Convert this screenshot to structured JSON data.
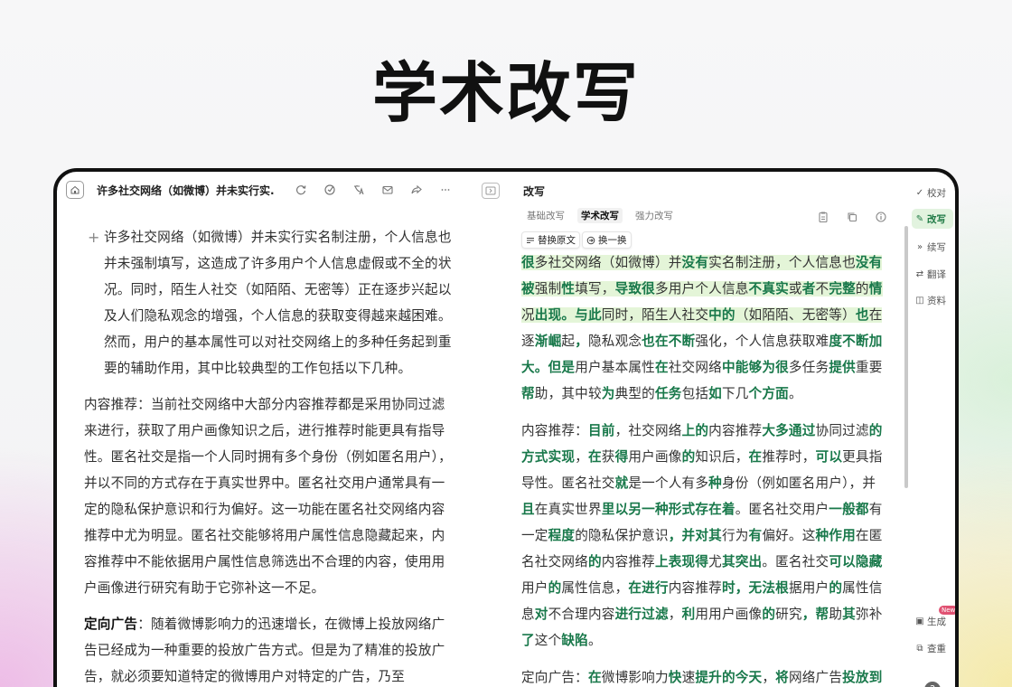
{
  "hero": {
    "title": "学术改写"
  },
  "left": {
    "doc_title": "许多社交网络（如微博）并未实行实...",
    "paragraphs": {
      "p1": "许多社交网络（如微博）并未实行实名制注册，个人信息也并未强制填写，这造成了许多用户个人信息虚假或不全的状况。同时，陌生人社交（如陌陌、无密等）正在逐步兴起以及人们隐私观念的增强，个人信息的获取变得越来越困难。然而，用户的基本属性可以对社交网络上的多种任务起到重要的辅助作用，其中比较典型的工作包括以下几种。",
      "p2": "内容推荐：当前社交网络中大部分内容推荐都是采用协同过滤来进行，获取了用户画像知识之后，进行推荐时能更具有指导性。匿名社交是指一个人同时拥有多个身份（例如匿名用户），并以不同的方式存在于真实世界中。匿名社交用户通常具有一定的隐私保护意识和行为偏好。这一功能在匿名社交网络内容推荐中尤为明显。匿名社交能够将用户属性信息隐藏起来，内容推荐中不能依据用户属性信息筛选出不合理的内容，使用用户画像进行研究有助于它弥补这一不足。",
      "p3_label": "定向广告",
      "p3": "：随着微博影响力的迅速增长，在微博上投放网络广告已经成为一种重要的投放广告方式。但是为了精准的投放广告，就必须要知道特定的微博用户对特定的广告，乃至"
    }
  },
  "right": {
    "header": "改写",
    "tabs": [
      "基础改写",
      "学术改写",
      "强力改写"
    ],
    "actions": {
      "replace": "替换原文",
      "swap": "换一换"
    },
    "para1": [
      [
        "很",
        1
      ],
      [
        "多社交网络（如微博）并",
        0
      ],
      [
        "没有",
        1
      ],
      [
        "实名制注册，个人信息也",
        0
      ],
      [
        "没有",
        1
      ],
      [
        "被",
        1
      ],
      [
        "强制",
        0
      ],
      [
        "性",
        1
      ],
      [
        "填写，",
        0
      ],
      [
        "导致很",
        1
      ],
      [
        "多用户个人信息",
        0
      ],
      [
        "不真实",
        1
      ],
      [
        "或",
        0
      ],
      [
        "者",
        1
      ],
      [
        "不",
        0
      ],
      [
        "完整",
        1
      ],
      [
        "的",
        0
      ],
      [
        "情",
        1
      ],
      [
        "况",
        0
      ],
      [
        "出现。与此",
        1
      ],
      [
        "同时，陌生人社交",
        0
      ],
      [
        "中的",
        1
      ],
      [
        "（如陌陌、无密等）",
        0
      ],
      [
        "也",
        1
      ],
      [
        "在",
        0
      ]
    ],
    "para1b": [
      [
        "逐",
        0
      ],
      [
        "渐崛",
        1
      ],
      [
        "起",
        0
      ],
      [
        "，",
        1
      ],
      [
        "隐私观念",
        0
      ],
      [
        "也在不断",
        1
      ],
      [
        "强化，个人信息获取难",
        0
      ],
      [
        "度不断加",
        1
      ],
      [
        "大。但是",
        1
      ],
      [
        "用户基本属性",
        0
      ],
      [
        "在",
        1
      ],
      [
        "社交网络",
        0
      ],
      [
        "中能够为很",
        1
      ],
      [
        "多任务",
        0
      ],
      [
        "提供",
        1
      ],
      [
        "重要",
        0
      ],
      [
        "帮",
        1
      ],
      [
        "助，其中较",
        0
      ],
      [
        "为",
        1
      ],
      [
        "典型的",
        0
      ],
      [
        "任务",
        1
      ],
      [
        "包括",
        0
      ],
      [
        "如",
        1
      ],
      [
        "下几",
        0
      ],
      [
        "个方面",
        1
      ],
      [
        "。",
        0
      ]
    ],
    "para2": [
      [
        "内容推荐：",
        0
      ],
      [
        "目前",
        1
      ],
      [
        "，社交网络",
        0
      ],
      [
        "上的",
        1
      ],
      [
        "内容推荐",
        0
      ],
      [
        "大多通过",
        1
      ],
      [
        "协同过滤",
        0
      ],
      [
        "的",
        1
      ],
      [
        "方式实现",
        1
      ],
      [
        "，",
        0
      ],
      [
        "在",
        1
      ],
      [
        "获",
        0
      ],
      [
        "得",
        1
      ],
      [
        "用户画像",
        0
      ],
      [
        "的",
        1
      ],
      [
        "知识后，",
        0
      ],
      [
        "在",
        1
      ],
      [
        "推荐时，",
        0
      ],
      [
        "可以",
        1
      ],
      [
        "更具指",
        0
      ],
      [
        "导性。匿名社交",
        0
      ],
      [
        "就",
        1
      ],
      [
        "是一个人有多",
        0
      ],
      [
        "种",
        1
      ],
      [
        "身份（例如匿名用户），并",
        0
      ],
      [
        "且",
        1
      ],
      [
        "在真实世界",
        0
      ],
      [
        "里以另一种形式存在着",
        1
      ],
      [
        "。匿名社交用户",
        0
      ],
      [
        "一般都",
        1
      ],
      [
        "有",
        0
      ],
      [
        "一定",
        0
      ],
      [
        "程度",
        1
      ],
      [
        "的隐私保护意识",
        0
      ],
      [
        "，并对其",
        1
      ],
      [
        "行为",
        0
      ],
      [
        "有",
        1
      ],
      [
        "偏好。这",
        0
      ],
      [
        "种作用",
        1
      ],
      [
        "在匿",
        0
      ],
      [
        "名社交网络",
        0
      ],
      [
        "的",
        1
      ],
      [
        "内容推荐",
        0
      ],
      [
        "上表现得",
        1
      ],
      [
        "尤",
        0
      ],
      [
        "其突出",
        1
      ],
      [
        "。匿名社交",
        0
      ],
      [
        "可以隐藏",
        1
      ],
      [
        "用户",
        0
      ],
      [
        "的",
        1
      ],
      [
        "属性信息，",
        0
      ],
      [
        "在进行",
        1
      ],
      [
        "内容推荐",
        0
      ],
      [
        "时，无法根",
        1
      ],
      [
        "据用户",
        0
      ],
      [
        "的",
        1
      ],
      [
        "属性信",
        0
      ],
      [
        "息",
        0
      ],
      [
        "对",
        1
      ],
      [
        "不合理内容",
        0
      ],
      [
        "进行过滤",
        1
      ],
      [
        "，",
        0
      ],
      [
        "利",
        1
      ],
      [
        "用用户画像",
        0
      ],
      [
        "的",
        1
      ],
      [
        "研究",
        0
      ],
      [
        "，帮",
        1
      ],
      [
        "助",
        0
      ],
      [
        "其",
        1
      ],
      [
        "弥补",
        0
      ],
      [
        "了",
        1
      ],
      [
        "这个",
        0
      ],
      [
        "缺陷",
        1
      ],
      [
        "。",
        0
      ]
    ],
    "para3": [
      [
        "定向广告：",
        0
      ],
      [
        "在",
        1
      ],
      [
        "微博影响力",
        0
      ],
      [
        "快",
        1
      ],
      [
        "速",
        0
      ],
      [
        "提升的今天",
        1
      ],
      [
        "，",
        0
      ],
      [
        "将",
        1
      ],
      [
        "网络广告",
        0
      ],
      [
        "投放到",
        1
      ]
    ]
  },
  "sidebar": {
    "items": [
      {
        "label": "校对",
        "icon": "check-icon"
      },
      {
        "label": "改写",
        "icon": "rewrite-icon"
      },
      {
        "label": "续写",
        "icon": "continue-icon"
      },
      {
        "label": "翻译",
        "icon": "translate-icon"
      },
      {
        "label": "资料",
        "icon": "library-icon"
      },
      {
        "label": "生成",
        "icon": "generate-icon"
      },
      {
        "label": "查重",
        "icon": "duplicate-check-icon"
      }
    ],
    "new_badge": "New",
    "help": "?"
  },
  "colors": {
    "accent_green": "#18784a",
    "highlight": "#e4f5d8",
    "active_bg": "#e2f3df"
  }
}
